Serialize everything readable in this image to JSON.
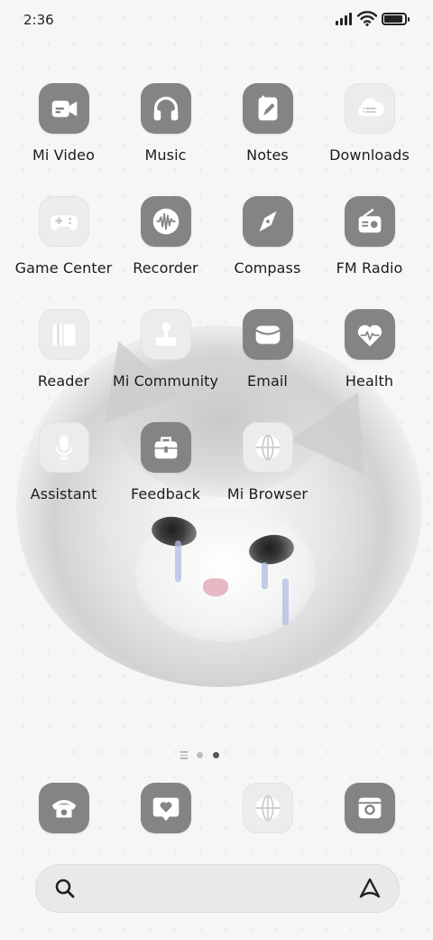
{
  "status_bar": {
    "time": "2:36",
    "battery_level": 0.9
  },
  "apps": [
    {
      "label": "Mi Video",
      "icon": "video-camera-icon",
      "style": "dark"
    },
    {
      "label": "Music",
      "icon": "headphones-icon",
      "style": "dark"
    },
    {
      "label": "Notes",
      "icon": "note-pencil-icon",
      "style": "dark"
    },
    {
      "label": "Downloads",
      "icon": "cloud-download-icon",
      "style": "light"
    },
    {
      "label": "Game Center",
      "icon": "gamepad-icon",
      "style": "light"
    },
    {
      "label": "Recorder",
      "icon": "waveform-icon",
      "style": "dark"
    },
    {
      "label": "Compass",
      "icon": "compass-needle-icon",
      "style": "dark"
    },
    {
      "label": "FM Radio",
      "icon": "radio-icon",
      "style": "dark"
    },
    {
      "label": "Reader",
      "icon": "book-icon",
      "style": "light"
    },
    {
      "label": "Mi Community",
      "icon": "joystick-icon",
      "style": "light"
    },
    {
      "label": "Email",
      "icon": "envelope-icon",
      "style": "dark"
    },
    {
      "label": "Health",
      "icon": "heart-pulse-icon",
      "style": "dark"
    },
    {
      "label": "Assistant",
      "icon": "microphone-icon",
      "style": "light"
    },
    {
      "label": "Feedback",
      "icon": "toolbox-icon",
      "style": "dark"
    },
    {
      "label": "Mi Browser",
      "icon": "globe-icon",
      "style": "light"
    }
  ],
  "dock": [
    {
      "name": "dock-phone",
      "icon": "phone-icon",
      "style": "dark"
    },
    {
      "name": "dock-messages",
      "icon": "message-heart-icon",
      "style": "dark"
    },
    {
      "name": "dock-browser",
      "icon": "globe-icon",
      "style": "light"
    },
    {
      "name": "dock-camera",
      "icon": "camera-icon",
      "style": "dark"
    }
  ],
  "page_indicator": {
    "pages": 2,
    "active": 2
  },
  "colors": {
    "icon_dark": "#848484",
    "icon_light": "#ececec",
    "label": "#1c1c1c",
    "dot_active": "#555555",
    "dot_inactive": "#bdbdbd"
  }
}
